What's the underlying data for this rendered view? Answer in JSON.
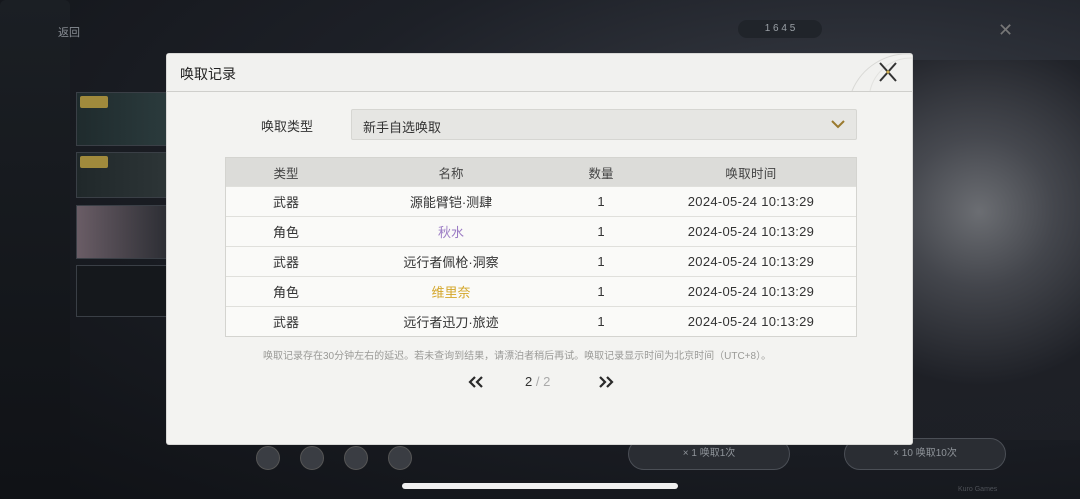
{
  "background": {
    "back_label": "返回",
    "currency_value": "1 6 4 5",
    "tags": [
      "",
      ""
    ],
    "pill_left": "× 1    唤取1次",
    "pill_right": "× 10    唤取10次",
    "footer": "Kuro Games"
  },
  "dialog": {
    "title": "唤取记录",
    "type_label": "唤取类型",
    "selected_type": "新手自选唤取",
    "table": {
      "headers": [
        "类型",
        "名称",
        "数量",
        "唤取时间"
      ],
      "rows": [
        {
          "type": "武器",
          "name": "源能臂铠·测肆",
          "qty": "1",
          "time": "2024-05-24 10:13:29",
          "rarity": "normal"
        },
        {
          "type": "角色",
          "name": "秋水",
          "qty": "1",
          "time": "2024-05-24 10:13:29",
          "rarity": "purple"
        },
        {
          "type": "武器",
          "name": "远行者佩枪·洞察",
          "qty": "1",
          "time": "2024-05-24 10:13:29",
          "rarity": "normal"
        },
        {
          "type": "角色",
          "name": "维里奈",
          "qty": "1",
          "time": "2024-05-24 10:13:29",
          "rarity": "gold"
        },
        {
          "type": "武器",
          "name": "远行者迅刀·旅迹",
          "qty": "1",
          "time": "2024-05-24 10:13:29",
          "rarity": "normal"
        }
      ]
    },
    "notice": "唤取记录存在30分钟左右的延迟。若未查询到结果，请漂泊者稍后再试。唤取记录显示时间为北京时间（UTC+8）。",
    "pagination": {
      "current": "2",
      "separator": "/",
      "total": "2"
    }
  },
  "colors": {
    "rarity_purple": "#9b7bc4",
    "rarity_gold": "#d4a62a",
    "dialog_bg": "#f3f3f1",
    "header_row": "#dcdcd9"
  },
  "icons": [
    "close-icon",
    "chevron-down-icon",
    "double-chevron-left-icon",
    "double-chevron-right-icon"
  ]
}
